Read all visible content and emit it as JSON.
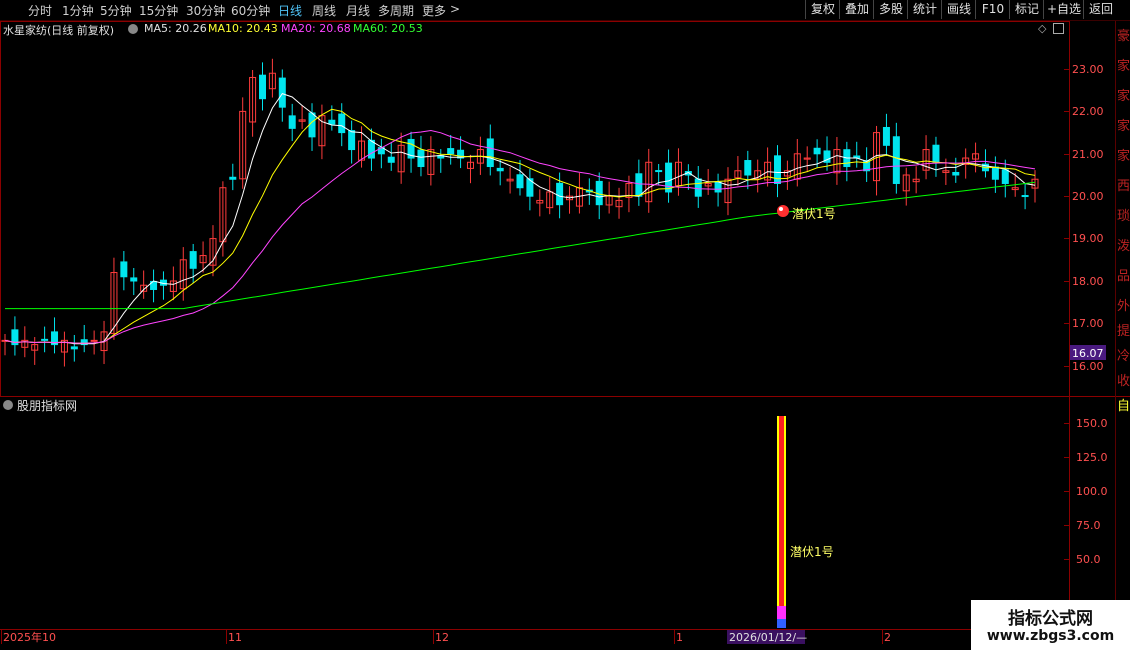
{
  "topbar": {
    "timeframes": [
      {
        "label": "分时",
        "active": false
      },
      {
        "label": "1分钟",
        "active": false
      },
      {
        "label": "5分钟",
        "active": false
      },
      {
        "label": "15分钟",
        "active": false
      },
      {
        "label": "30分钟",
        "active": false
      },
      {
        "label": "60分钟",
        "active": false
      },
      {
        "label": "日线",
        "active": true
      },
      {
        "label": "周线",
        "active": false
      },
      {
        "label": "月线",
        "active": false
      },
      {
        "label": "多周期",
        "active": false
      },
      {
        "label": "更多",
        "active": false
      }
    ],
    "more_arrow": ">",
    "right_buttons": [
      "复权",
      "叠加",
      "多股",
      "统计",
      "画线",
      "F10",
      "标记",
      "+自选",
      "返回"
    ]
  },
  "legend": {
    "stock_name": "水星家纺(日线 前复权)",
    "ma5": "MA5: 20.26",
    "ma10": "MA10: 20.43",
    "ma20": "MA20: 20.68",
    "ma60": "MA60: 20.53"
  },
  "price_axis": {
    "ticks": [
      "23.00",
      "22.00",
      "21.00",
      "20.00",
      "19.00",
      "18.00",
      "17.00",
      "16.00"
    ],
    "current_price": "16.07"
  },
  "annotations": {
    "signal_label": "潜伏1号",
    "indicator_signal_label": "潜伏1号"
  },
  "indicator": {
    "name": "股朋指标网",
    "ticks": [
      "150.0",
      "125.0",
      "100.0",
      "75.0",
      "50.0"
    ]
  },
  "date_axis": {
    "labels": [
      "2025年10",
      "11",
      "12",
      "1",
      "2"
    ],
    "cursor_date": "2026/01/12/—"
  },
  "right_side_glyphs": [
    "豪",
    "家",
    "家",
    "家",
    "家",
    "西",
    "琐",
    "泼",
    "品",
    "外",
    "提",
    "冷",
    "收",
    "自"
  ],
  "colors": {
    "up": "#ff3c3c",
    "down": "#00e5ee",
    "ma5": "#ffffff",
    "ma10": "#ffff00",
    "ma20": "#ff44ff",
    "ma60": "#00ff00",
    "frame": "#8b0000"
  },
  "watermark": {
    "title": "指标公式网",
    "url": "www.zbgs3.com"
  }
}
